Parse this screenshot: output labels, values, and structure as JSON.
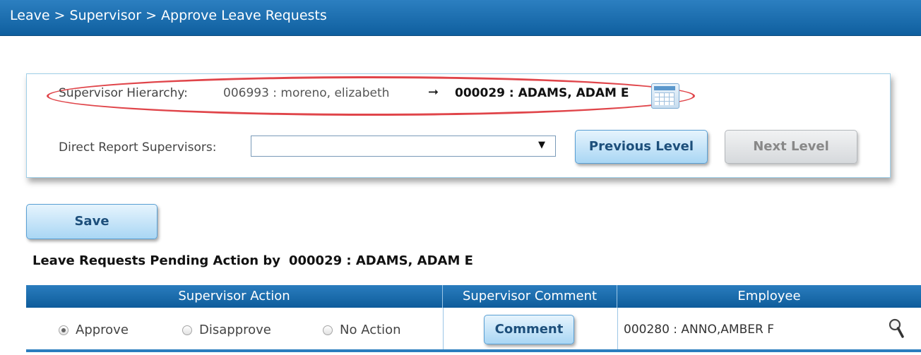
{
  "breadcrumb": "Leave > Supervisor > Approve Leave Requests",
  "hierarchy": {
    "label": "Supervisor Hierarchy:",
    "from": "006993 : moreno, elizabeth",
    "arrow": "➞",
    "to": "000029 : ADAMS, ADAM E",
    "icon": "calendar-icon"
  },
  "direct_report": {
    "label": "Direct Report Supervisors:",
    "value": "",
    "caret": "▼"
  },
  "buttons": {
    "previous_level": "Previous Level",
    "next_level": "Next Level",
    "save": "Save"
  },
  "pending": {
    "title": "Leave Requests Pending Action by",
    "supervisor": "000029 : ADAMS, ADAM E"
  },
  "grid": {
    "columns": [
      "Supervisor Action",
      "Supervisor Comment",
      "Employee"
    ],
    "rows": [
      {
        "actions": [
          "Approve",
          "Disapprove",
          "No Action"
        ],
        "selected_action": "Approve",
        "comment_label": "Comment",
        "employee": "000280 : ANNO,AMBER F",
        "employee_icon": "magnifier-icon"
      }
    ]
  },
  "colors": {
    "header_blue": "#1a6fb0",
    "highlight_oval": "#e0454a",
    "button_blue": "#a9d6f4",
    "button_disabled": "#d6d9dc"
  }
}
